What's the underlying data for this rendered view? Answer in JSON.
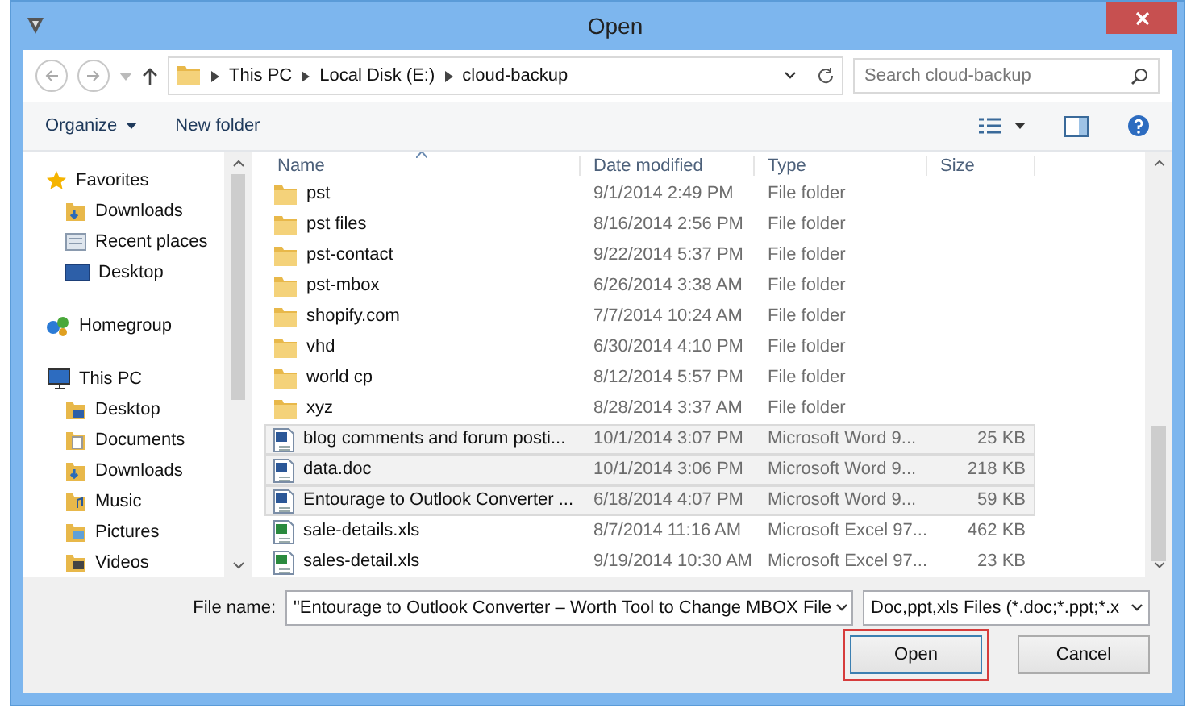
{
  "window": {
    "title": "Open"
  },
  "address": {
    "crumbs": [
      "This PC",
      "Local Disk (E:)",
      "cloud-backup"
    ],
    "search_placeholder": "Search cloud-backup"
  },
  "toolbar": {
    "organize": "Organize",
    "new_folder": "New folder"
  },
  "nav": [
    {
      "label": "Favorites",
      "kind": "star",
      "children": [
        {
          "label": "Downloads",
          "kind": "downloads"
        },
        {
          "label": "Recent places",
          "kind": "recent"
        },
        {
          "label": "Desktop",
          "kind": "desktop"
        }
      ]
    },
    {
      "label": "Homegroup",
      "kind": "homegroup"
    },
    {
      "label": "This PC",
      "kind": "pc",
      "children": [
        {
          "label": "Desktop",
          "kind": "desktop-folder"
        },
        {
          "label": "Documents",
          "kind": "documents"
        },
        {
          "label": "Downloads",
          "kind": "downloads"
        },
        {
          "label": "Music",
          "kind": "music"
        },
        {
          "label": "Pictures",
          "kind": "pictures"
        },
        {
          "label": "Videos",
          "kind": "videos"
        }
      ]
    }
  ],
  "table": {
    "columns": [
      "Name",
      "Date modified",
      "Type",
      "Size"
    ],
    "rows": [
      {
        "kind": "folder",
        "name": "pst",
        "date": "9/1/2014 2:49 PM",
        "type": "File folder",
        "selected": false
      },
      {
        "kind": "folder",
        "name": "pst files",
        "date": "8/16/2014 2:56 PM",
        "type": "File folder",
        "selected": false
      },
      {
        "kind": "folder",
        "name": "pst-contact",
        "date": "9/22/2014 5:37 PM",
        "type": "File folder",
        "selected": false
      },
      {
        "kind": "folder",
        "name": "pst-mbox",
        "date": "6/26/2014 3:38 AM",
        "type": "File folder",
        "selected": false
      },
      {
        "kind": "folder",
        "name": "shopify.com",
        "date": "7/7/2014 10:24 AM",
        "type": "File folder",
        "selected": false
      },
      {
        "kind": "folder",
        "name": "vhd",
        "date": "6/30/2014 4:10 PM",
        "type": "File folder",
        "selected": false
      },
      {
        "kind": "folder",
        "name": "world cp",
        "date": "8/12/2014 5:57 PM",
        "type": "File folder",
        "selected": false
      },
      {
        "kind": "folder",
        "name": "xyz",
        "date": "8/28/2014 3:37 AM",
        "type": "File folder",
        "selected": false
      },
      {
        "kind": "word",
        "name": "blog comments and forum posti...",
        "date": "10/1/2014 3:07 PM",
        "type": "Microsoft Word 9...",
        "size": "25 KB",
        "selected": true
      },
      {
        "kind": "word",
        "name": "data.doc",
        "date": "10/1/2014 3:06 PM",
        "type": "Microsoft Word 9...",
        "size": "218 KB",
        "selected": true
      },
      {
        "kind": "word",
        "name": "Entourage to Outlook Converter ...",
        "date": "6/18/2014 4:07 PM",
        "type": "Microsoft Word 9...",
        "size": "59 KB",
        "selected": true
      },
      {
        "kind": "excel",
        "name": "sale-details.xls",
        "date": "8/7/2014 11:16 AM",
        "type": "Microsoft Excel 97...",
        "size": "462 KB",
        "selected": false
      },
      {
        "kind": "excel",
        "name": "sales-detail.xls",
        "date": "9/19/2014 10:30 AM",
        "type": "Microsoft Excel 97...",
        "size": "23 KB",
        "selected": false
      }
    ]
  },
  "footer": {
    "file_name_label": "File name:",
    "file_name_value": "\"Entourage to Outlook Converter – Worth Tool to Change MBOX File",
    "filter": "Doc,ppt,xls Files (*.doc;*.ppt;*.x",
    "open": "Open",
    "cancel": "Cancel"
  }
}
